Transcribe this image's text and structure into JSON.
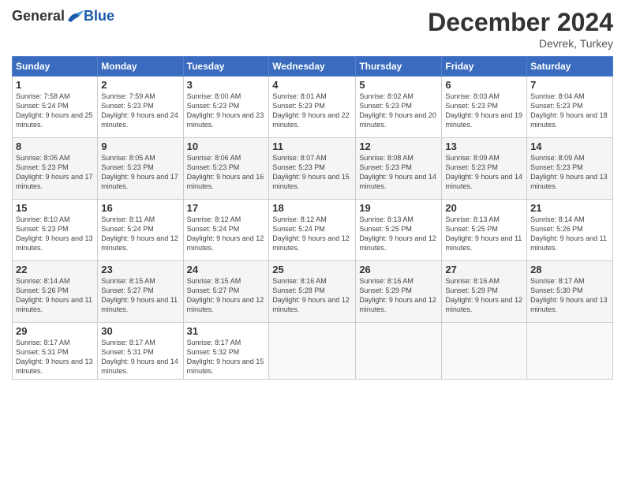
{
  "header": {
    "logo_general": "General",
    "logo_blue": "Blue",
    "month_title": "December 2024",
    "subtitle": "Devrek, Turkey"
  },
  "columns": [
    "Sunday",
    "Monday",
    "Tuesday",
    "Wednesday",
    "Thursday",
    "Friday",
    "Saturday"
  ],
  "weeks": [
    [
      {
        "day": "1",
        "sunrise": "Sunrise: 7:58 AM",
        "sunset": "Sunset: 5:24 PM",
        "daylight": "Daylight: 9 hours and 25 minutes."
      },
      {
        "day": "2",
        "sunrise": "Sunrise: 7:59 AM",
        "sunset": "Sunset: 5:23 PM",
        "daylight": "Daylight: 9 hours and 24 minutes."
      },
      {
        "day": "3",
        "sunrise": "Sunrise: 8:00 AM",
        "sunset": "Sunset: 5:23 PM",
        "daylight": "Daylight: 9 hours and 23 minutes."
      },
      {
        "day": "4",
        "sunrise": "Sunrise: 8:01 AM",
        "sunset": "Sunset: 5:23 PM",
        "daylight": "Daylight: 9 hours and 22 minutes."
      },
      {
        "day": "5",
        "sunrise": "Sunrise: 8:02 AM",
        "sunset": "Sunset: 5:23 PM",
        "daylight": "Daylight: 9 hours and 20 minutes."
      },
      {
        "day": "6",
        "sunrise": "Sunrise: 8:03 AM",
        "sunset": "Sunset: 5:23 PM",
        "daylight": "Daylight: 9 hours and 19 minutes."
      },
      {
        "day": "7",
        "sunrise": "Sunrise: 8:04 AM",
        "sunset": "Sunset: 5:23 PM",
        "daylight": "Daylight: 9 hours and 18 minutes."
      }
    ],
    [
      {
        "day": "8",
        "sunrise": "Sunrise: 8:05 AM",
        "sunset": "Sunset: 5:23 PM",
        "daylight": "Daylight: 9 hours and 17 minutes."
      },
      {
        "day": "9",
        "sunrise": "Sunrise: 8:05 AM",
        "sunset": "Sunset: 5:23 PM",
        "daylight": "Daylight: 9 hours and 17 minutes."
      },
      {
        "day": "10",
        "sunrise": "Sunrise: 8:06 AM",
        "sunset": "Sunset: 5:23 PM",
        "daylight": "Daylight: 9 hours and 16 minutes."
      },
      {
        "day": "11",
        "sunrise": "Sunrise: 8:07 AM",
        "sunset": "Sunset: 5:23 PM",
        "daylight": "Daylight: 9 hours and 15 minutes."
      },
      {
        "day": "12",
        "sunrise": "Sunrise: 8:08 AM",
        "sunset": "Sunset: 5:23 PM",
        "daylight": "Daylight: 9 hours and 14 minutes."
      },
      {
        "day": "13",
        "sunrise": "Sunrise: 8:09 AM",
        "sunset": "Sunset: 5:23 PM",
        "daylight": "Daylight: 9 hours and 14 minutes."
      },
      {
        "day": "14",
        "sunrise": "Sunrise: 8:09 AM",
        "sunset": "Sunset: 5:23 PM",
        "daylight": "Daylight: 9 hours and 13 minutes."
      }
    ],
    [
      {
        "day": "15",
        "sunrise": "Sunrise: 8:10 AM",
        "sunset": "Sunset: 5:23 PM",
        "daylight": "Daylight: 9 hours and 13 minutes."
      },
      {
        "day": "16",
        "sunrise": "Sunrise: 8:11 AM",
        "sunset": "Sunset: 5:24 PM",
        "daylight": "Daylight: 9 hours and 12 minutes."
      },
      {
        "day": "17",
        "sunrise": "Sunrise: 8:12 AM",
        "sunset": "Sunset: 5:24 PM",
        "daylight": "Daylight: 9 hours and 12 minutes."
      },
      {
        "day": "18",
        "sunrise": "Sunrise: 8:12 AM",
        "sunset": "Sunset: 5:24 PM",
        "daylight": "Daylight: 9 hours and 12 minutes."
      },
      {
        "day": "19",
        "sunrise": "Sunrise: 8:13 AM",
        "sunset": "Sunset: 5:25 PM",
        "daylight": "Daylight: 9 hours and 12 minutes."
      },
      {
        "day": "20",
        "sunrise": "Sunrise: 8:13 AM",
        "sunset": "Sunset: 5:25 PM",
        "daylight": "Daylight: 9 hours and 11 minutes."
      },
      {
        "day": "21",
        "sunrise": "Sunrise: 8:14 AM",
        "sunset": "Sunset: 5:26 PM",
        "daylight": "Daylight: 9 hours and 11 minutes."
      }
    ],
    [
      {
        "day": "22",
        "sunrise": "Sunrise: 8:14 AM",
        "sunset": "Sunset: 5:26 PM",
        "daylight": "Daylight: 9 hours and 11 minutes."
      },
      {
        "day": "23",
        "sunrise": "Sunrise: 8:15 AM",
        "sunset": "Sunset: 5:27 PM",
        "daylight": "Daylight: 9 hours and 11 minutes."
      },
      {
        "day": "24",
        "sunrise": "Sunrise: 8:15 AM",
        "sunset": "Sunset: 5:27 PM",
        "daylight": "Daylight: 9 hours and 12 minutes."
      },
      {
        "day": "25",
        "sunrise": "Sunrise: 8:16 AM",
        "sunset": "Sunset: 5:28 PM",
        "daylight": "Daylight: 9 hours and 12 minutes."
      },
      {
        "day": "26",
        "sunrise": "Sunrise: 8:16 AM",
        "sunset": "Sunset: 5:29 PM",
        "daylight": "Daylight: 9 hours and 12 minutes."
      },
      {
        "day": "27",
        "sunrise": "Sunrise: 8:16 AM",
        "sunset": "Sunset: 5:29 PM",
        "daylight": "Daylight: 9 hours and 12 minutes."
      },
      {
        "day": "28",
        "sunrise": "Sunrise: 8:17 AM",
        "sunset": "Sunset: 5:30 PM",
        "daylight": "Daylight: 9 hours and 13 minutes."
      }
    ],
    [
      {
        "day": "29",
        "sunrise": "Sunrise: 8:17 AM",
        "sunset": "Sunset: 5:31 PM",
        "daylight": "Daylight: 9 hours and 13 minutes."
      },
      {
        "day": "30",
        "sunrise": "Sunrise: 8:17 AM",
        "sunset": "Sunset: 5:31 PM",
        "daylight": "Daylight: 9 hours and 14 minutes."
      },
      {
        "day": "31",
        "sunrise": "Sunrise: 8:17 AM",
        "sunset": "Sunset: 5:32 PM",
        "daylight": "Daylight: 9 hours and 15 minutes."
      },
      null,
      null,
      null,
      null
    ]
  ]
}
